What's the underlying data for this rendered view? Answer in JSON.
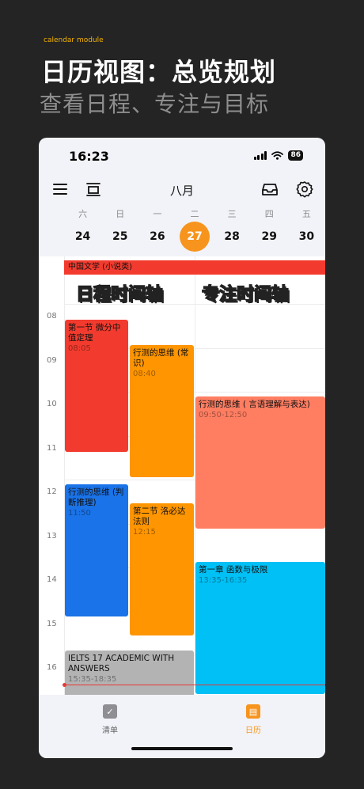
{
  "promo": {
    "module_tag": "calendar module",
    "headline": "日历视图：总览规划",
    "subheadline": "查看日程、专注与目标"
  },
  "status_bar": {
    "time": "16:23",
    "battery": "86"
  },
  "toolbar": {
    "month": "八月"
  },
  "icons": {
    "menu": "menu-icon",
    "tofu": "tofu-icon",
    "inbox": "inbox-icon",
    "settings": "gear-icon",
    "list_tab": "checkbox-icon",
    "calendar_tab": "calendar-icon"
  },
  "week": {
    "weekdays": [
      "六",
      "日",
      "一",
      "二",
      "三",
      "四",
      "五"
    ],
    "dates": [
      "24",
      "25",
      "26",
      "27",
      "28",
      "29",
      "30"
    ],
    "today_index": 3
  },
  "hours": [
    "08",
    "09",
    "10",
    "11",
    "12",
    "13",
    "14",
    "15",
    "16"
  ],
  "allday_event": {
    "title": "中国文学 (小说类)",
    "color": "#f23b2e"
  },
  "overlay": {
    "left": "日程时间轴",
    "right": "专注时间轴"
  },
  "events": [
    {
      "title": "第一节 微分中值定理",
      "time": "08:05",
      "color": "#f23b2e"
    },
    {
      "title": "行测的思维 (常识)",
      "time": "08:40",
      "color": "#ff9500"
    },
    {
      "title": "行测的思维 ( 言语理解与表达)",
      "time": "09:50-12:50",
      "color": "#ff7e62"
    },
    {
      "title": "行测的思维 (判断推理)",
      "time": "11:50",
      "color": "#1a73e8"
    },
    {
      "title": "第二节 洛必达法则",
      "time": "12:15",
      "color": "#ff9500"
    },
    {
      "title": "第一章 函数与极限",
      "time": "13:35-16:35",
      "color": "#00c0f5"
    },
    {
      "title": "IELTS 17 ACADEMIC WITH ANSWERS",
      "time": "15:35-18:35",
      "color": "#b3b3b3"
    }
  ],
  "tabs": {
    "list": "清单",
    "calendar": "日历"
  },
  "colors": {
    "accent": "#f7941d",
    "now_line": "#e53935"
  }
}
